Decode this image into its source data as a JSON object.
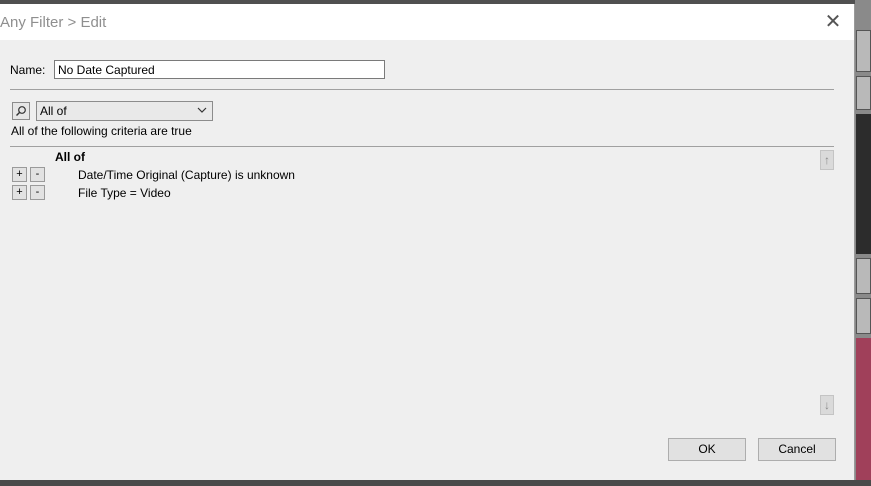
{
  "window": {
    "title": "Any Filter > Edit",
    "close_glyph": "✕"
  },
  "form": {
    "name_label": "Name:",
    "name_value": "No Date Captured",
    "match_options_selected": "All of",
    "description": "All of the following criteria are true"
  },
  "rules": {
    "group_label": "All of",
    "items": [
      {
        "text": "Date/Time Original (Capture) is unknown",
        "add": "+",
        "remove": "-"
      },
      {
        "text": "File Type = Video",
        "add": "+",
        "remove": "-"
      }
    ]
  },
  "buttons": {
    "ok": "OK",
    "cancel": "Cancel"
  },
  "icons": {
    "search": "search-icon",
    "dropdown": "chevron-down-icon",
    "scroll_up": "arrow-up-icon",
    "scroll_down": "arrow-down-icon"
  }
}
